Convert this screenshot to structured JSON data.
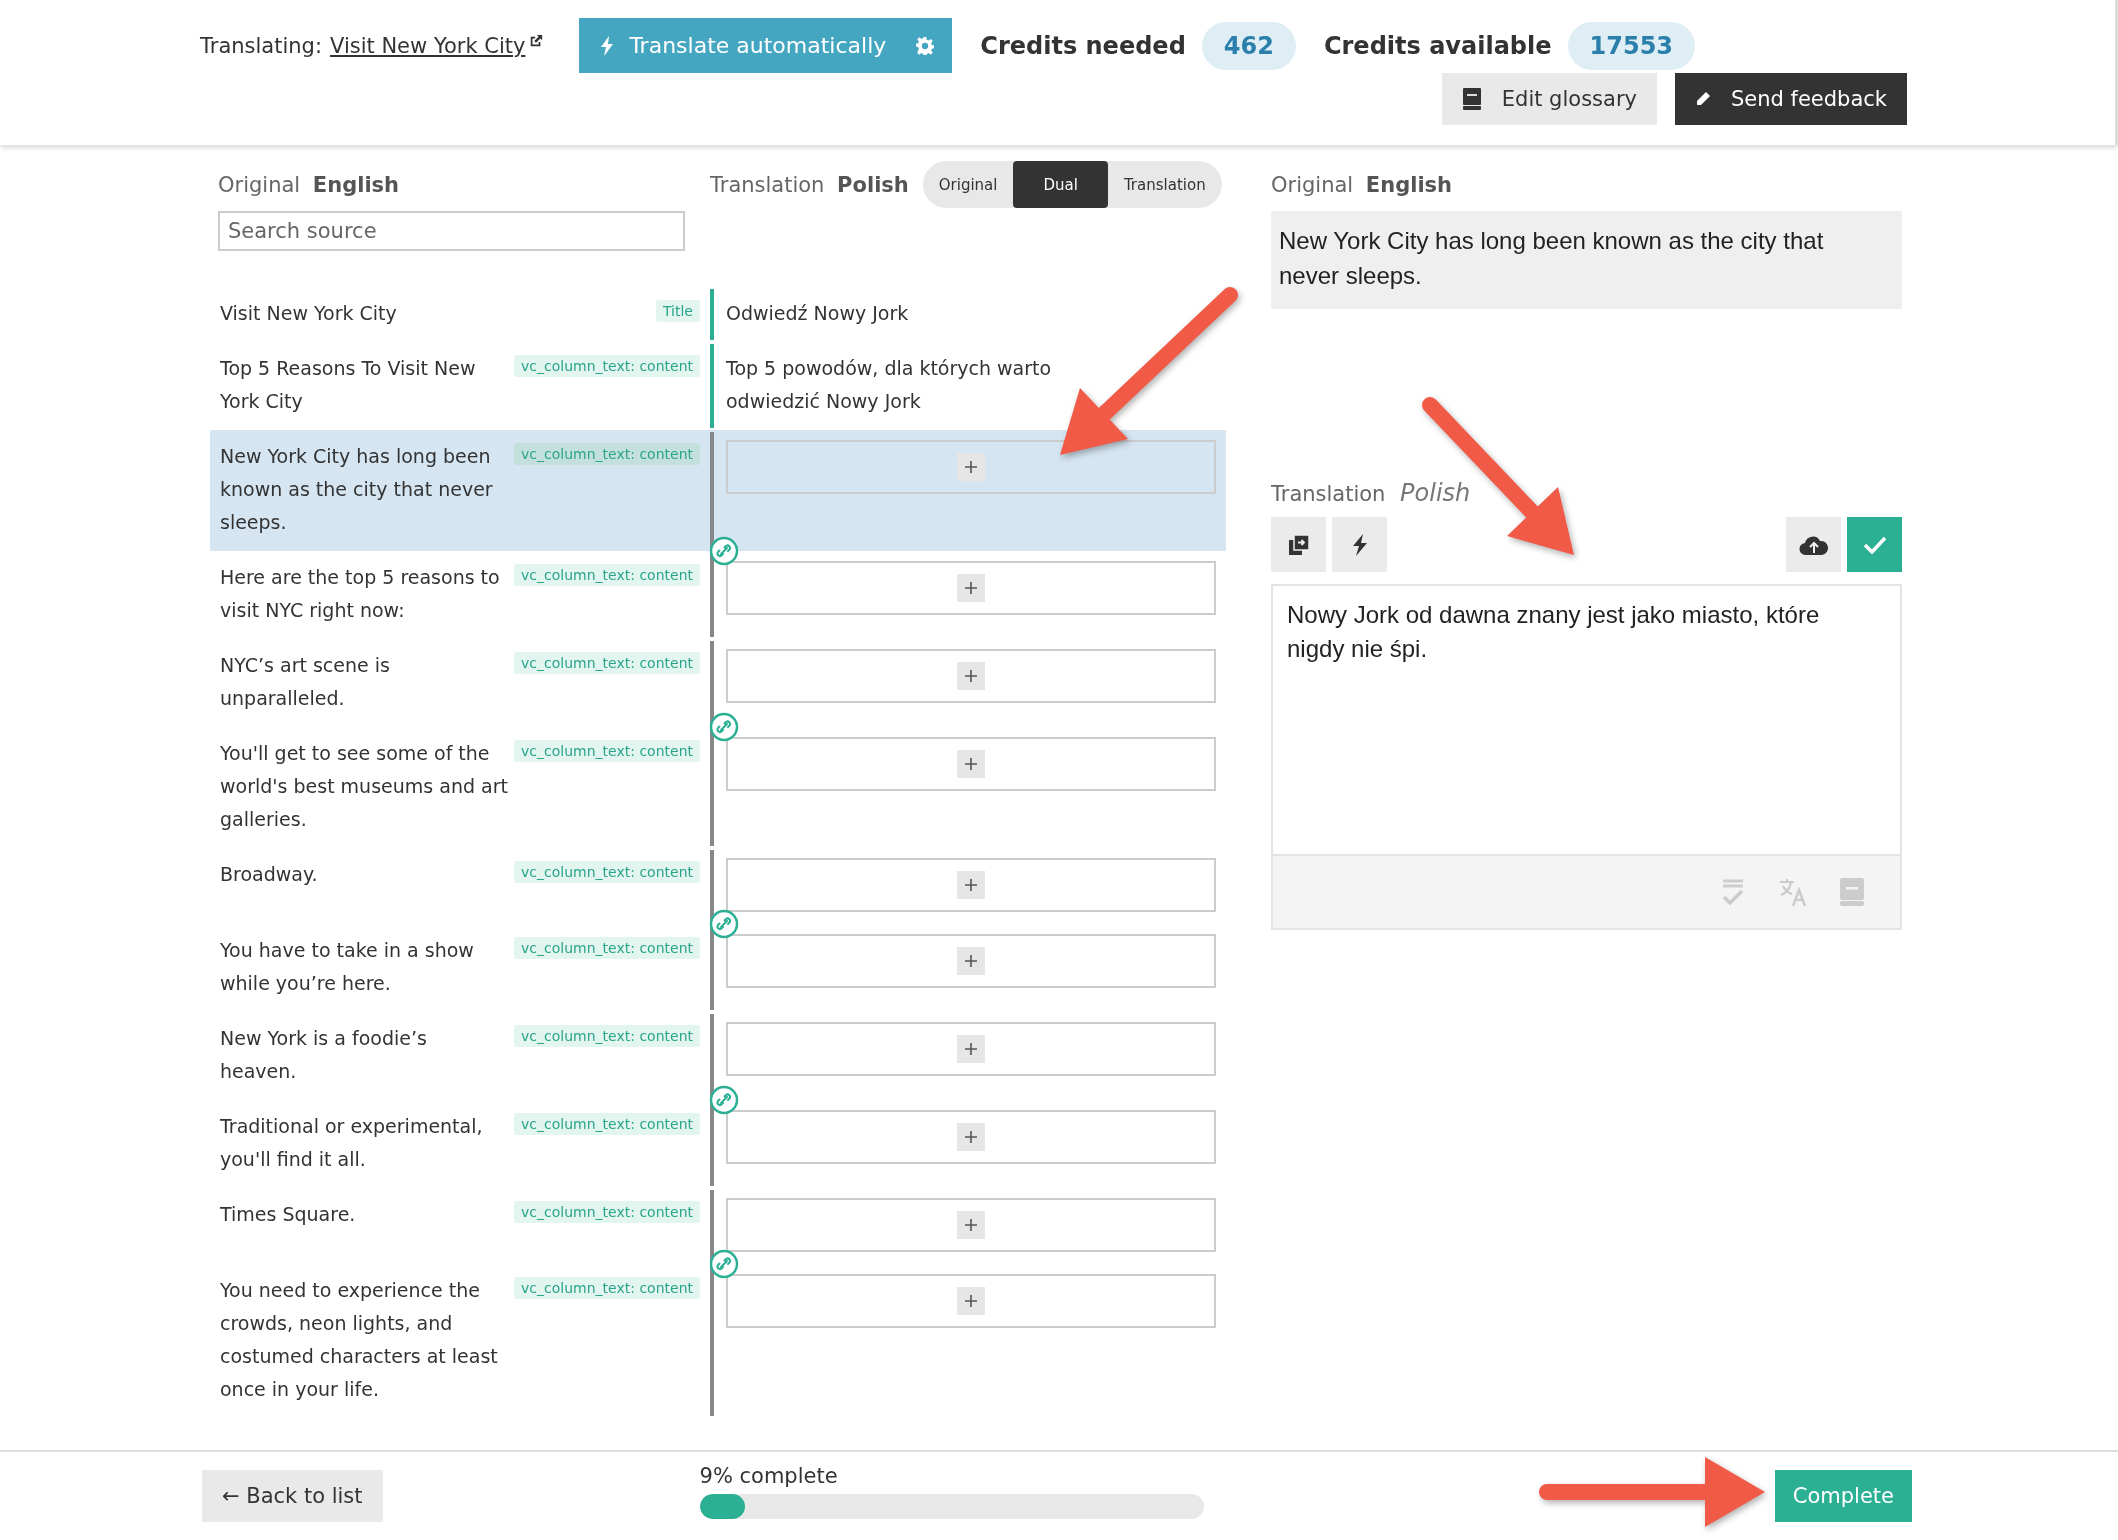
{
  "header": {
    "label": "Translating:",
    "link": "Visit New York City",
    "translate_button": "Translate automatically",
    "credits": [
      {
        "label": "Credits needed",
        "value": "462"
      },
      {
        "label": "Credits available",
        "value": "17553"
      }
    ],
    "buttons": [
      {
        "label": "Edit glossary",
        "kind": "glossary"
      },
      {
        "label": "Send feedback",
        "kind": "feedback"
      }
    ]
  },
  "source_header": {
    "label": "Original",
    "language": "English",
    "search_placeholder": "Search source"
  },
  "translation_header": {
    "label": "Translation",
    "language": "Polish",
    "modes": [
      {
        "label": "Original",
        "selected": false
      },
      {
        "label": "Dual",
        "selected": true
      },
      {
        "label": "Translation",
        "selected": false
      }
    ]
  },
  "rows": [
    {
      "source": "Visit New York City",
      "tag": "Title",
      "translation": "Odwiedź Nowy Jork",
      "selected": false,
      "linked": false
    },
    {
      "source": "Top 5 Reasons To Visit New York City",
      "tag": "vc_column_text: content",
      "translation": "Top 5 powodów, dla których warto odwiedzić Nowy Jork",
      "selected": false,
      "linked": false
    },
    {
      "source": "New York City has long been known as the city that never sleeps.",
      "tag": "vc_column_text: content",
      "translation": "",
      "selected": true,
      "linked": true
    },
    {
      "source": "Here are the top 5 reasons to visit NYC right now:",
      "tag": "vc_column_text: content",
      "translation": "",
      "selected": false,
      "linked": false
    },
    {
      "source": "NYC’s art scene is unparalleled.",
      "tag": "vc_column_text: content",
      "translation": "",
      "selected": false,
      "linked": true
    },
    {
      "source": "You'll get to see some of the world's best museums and art galleries.",
      "tag": "vc_column_text: content",
      "translation": "",
      "selected": false,
      "linked": false
    },
    {
      "source": "Broadway.",
      "tag": "vc_column_text: content",
      "translation": "",
      "selected": false,
      "linked": true
    },
    {
      "source": "You have to take in a show while you’re here.",
      "tag": "vc_column_text: content",
      "translation": "",
      "selected": false,
      "linked": false
    },
    {
      "source": "New York is a foodie’s heaven.",
      "tag": "vc_column_text: content",
      "translation": "",
      "selected": false,
      "linked": true
    },
    {
      "source": "Traditional or experimental, you'll find it all.",
      "tag": "vc_column_text: content",
      "translation": "",
      "selected": false,
      "linked": false
    },
    {
      "source": "Times Square.",
      "tag": "vc_column_text: content",
      "translation": "",
      "selected": false,
      "linked": true
    },
    {
      "source": "You need to experience the crowds, neon lights, and costumed characters at least once in your life.",
      "tag": "vc_column_text: content",
      "translation": "",
      "selected": false,
      "linked": false
    }
  ],
  "editor": {
    "original_label": "Original",
    "original_language": "English",
    "original_text": "New York City has long been known as the city that never sleeps.",
    "translation_label": "Translation",
    "translation_language": "Polish",
    "value": "Nowy Jork od dawna znany jest jako miasto, które nigdy nie śpi."
  },
  "footer": {
    "back_button": "← Back to list",
    "progress_label": "9% complete",
    "level": 0.09,
    "complete_button": "Complete"
  }
}
